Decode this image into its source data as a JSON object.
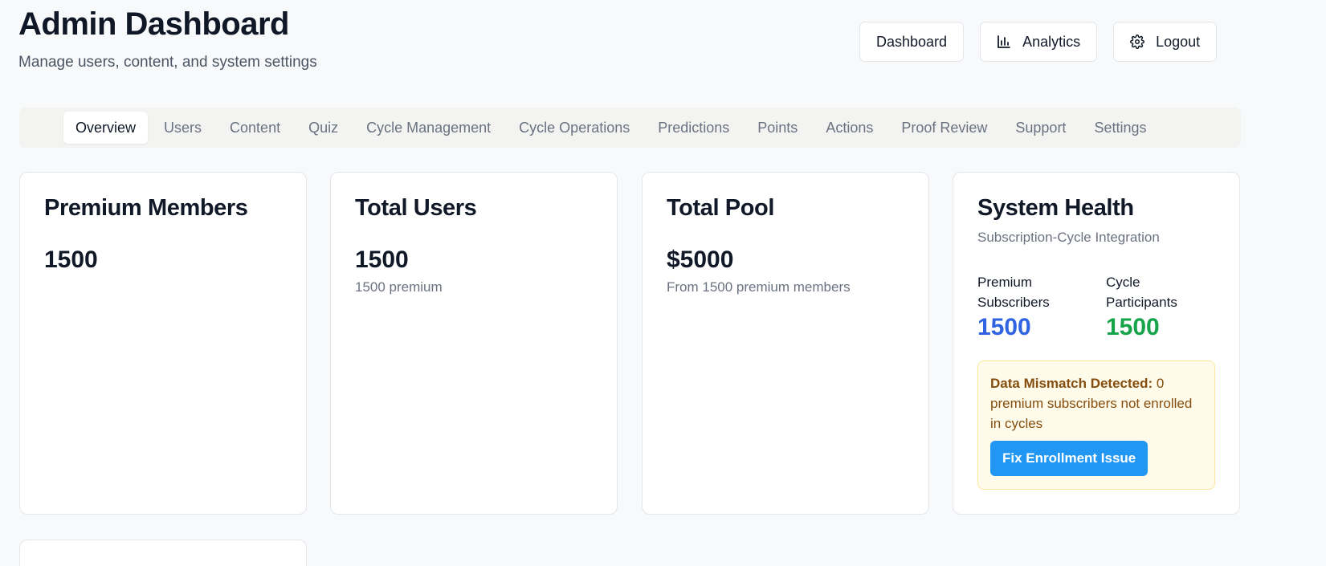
{
  "header": {
    "title": "Admin Dashboard",
    "subtitle": "Manage users, content, and system settings"
  },
  "top_actions": {
    "dashboard_label": "Dashboard",
    "analytics_label": "Analytics",
    "logout_label": "Logout",
    "analytics_icon": "bar-chart-icon",
    "logout_icon": "gear-icon"
  },
  "tabs": [
    {
      "label": "Overview",
      "active": true
    },
    {
      "label": "Users"
    },
    {
      "label": "Content"
    },
    {
      "label": "Quiz"
    },
    {
      "label": "Cycle Management"
    },
    {
      "label": "Cycle Operations"
    },
    {
      "label": "Predictions"
    },
    {
      "label": "Points"
    },
    {
      "label": "Actions"
    },
    {
      "label": "Proof Review"
    },
    {
      "label": "Support"
    },
    {
      "label": "Settings"
    }
  ],
  "cards": {
    "premium_members": {
      "title": "Premium Members",
      "value": "1500"
    },
    "total_users": {
      "title": "Total Users",
      "value": "1500",
      "sub": "1500 premium"
    },
    "total_pool": {
      "title": "Total Pool",
      "value": "$5000",
      "sub": "From 1500 premium members"
    },
    "system_health": {
      "title": "System Health",
      "subtitle": "Subscription-Cycle Integration",
      "premium_label_1": "Premium",
      "premium_label_2": "Subscribers",
      "premium_value": "1500",
      "cycle_label_1": "Cycle",
      "cycle_label_2": "Participants",
      "cycle_value": "1500",
      "alert_strong": "Data Mismatch Detected:",
      "alert_text": " 0 premium subscribers not enrolled in cycles",
      "fix_button": "Fix Enrollment Issue"
    }
  },
  "colors": {
    "premium_value": "#2f63e0",
    "cycle_value": "#16a34a",
    "alert_bg": "#fffbea",
    "fix_button": "#2196f3"
  }
}
